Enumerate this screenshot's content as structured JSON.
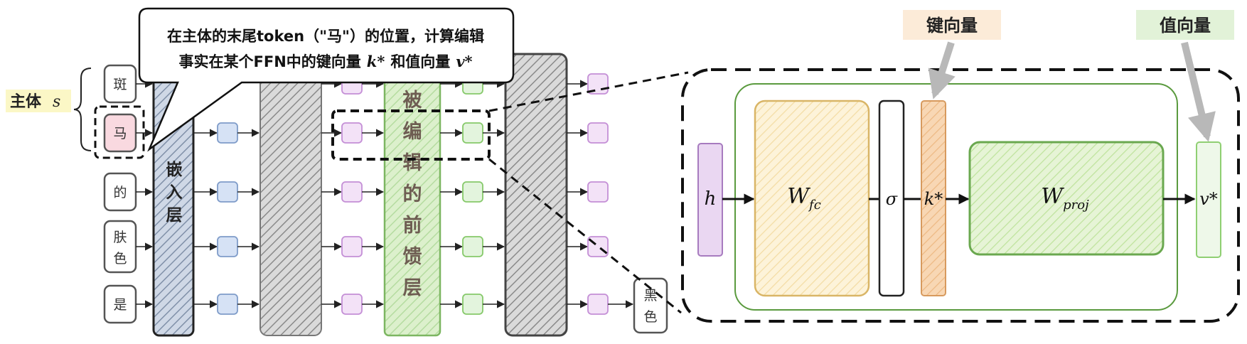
{
  "subject_label": "主体",
  "subject_var": "s",
  "tokens": [
    "斑",
    "马",
    "的",
    "肤色",
    "是"
  ],
  "embedding_layer_label": "嵌入层",
  "edited_layer_label": "被编辑的前馈层",
  "output_label": "黑色",
  "callout_line1": "在主体的末尾token（\"马\"）的位置，计算编辑",
  "callout_line2_prefix": "事实在某个FFN中的键向量",
  "callout_k": "k*",
  "callout_and": "和值向量",
  "callout_v": "v*",
  "key_vector_title": "键向量",
  "value_vector_title": "值向量",
  "ffn": {
    "h": "h",
    "w_fc": "W_fc",
    "sigma": "σ",
    "k_star": "k*",
    "w_proj": "W_proj",
    "v_star": "v*"
  },
  "colors": {
    "embed": "#c9d3e2",
    "gray_layer": "#cfcfcf",
    "edited": "#d5ecc2",
    "blue_node": "#d6e2f5",
    "purple_node": "#f3e2f7",
    "green_node": "#e3f4dd",
    "subject_highlight": "#fbf7c6",
    "key_title_bg": "#fcebd8",
    "value_title_bg": "#e2f2d8",
    "wfc": "#fbeecd",
    "kstar": "#f6d2ad",
    "wproj": "#ddefc8",
    "h": "#ead7f2",
    "vstar": "#eef8e9"
  }
}
